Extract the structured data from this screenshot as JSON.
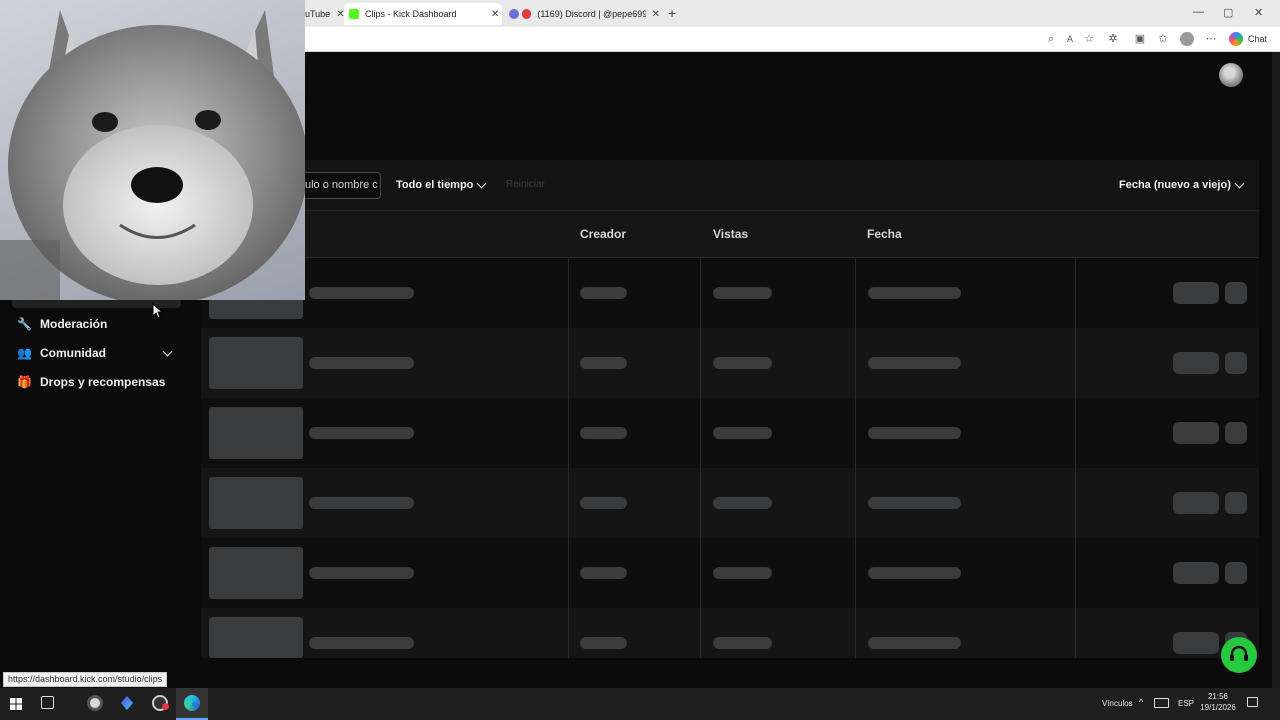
{
  "browser": {
    "tabs": [
      {
        "label": "uTube",
        "active": false
      },
      {
        "label": "Clips - Kick Dashboard",
        "active": true
      },
      {
        "label": "(1169) Discord | @pepe699",
        "active": false
      }
    ],
    "close_symbol": "✕",
    "new_tab_symbol": "+",
    "chat_label": "Chat",
    "window_controls": [
      "—",
      "▢",
      "✕"
    ]
  },
  "toolbar": {
    "search_value": "ulo o nombre c",
    "time_filter": "Todo el tiempo",
    "disabled_button": "Reiniciar",
    "sort_label": "Fecha (nuevo a viejo)"
  },
  "table": {
    "columns": [
      "Creador",
      "Vistas",
      "Fecha"
    ],
    "skeleton_rows": 6
  },
  "sidebar": {
    "items": [
      {
        "label": "Moderación",
        "icon": "wrench-icon",
        "glyph": "🔧"
      },
      {
        "label": "Comunidad",
        "icon": "users-icon",
        "glyph": "👥",
        "expandable": true
      },
      {
        "label": "Drops y recompensas",
        "icon": "gift-icon",
        "glyph": "🎁"
      }
    ]
  },
  "status_url": "https://dashboard.kick.com/studio/clips",
  "taskbar": {
    "links_label": "Vínculos",
    "lang": "ESP",
    "time": "21:56",
    "date": "19/1/2026"
  },
  "colors": {
    "kick_green": "#53fc18",
    "help_green": "#27c93f",
    "discord_red": "#e0383e"
  }
}
